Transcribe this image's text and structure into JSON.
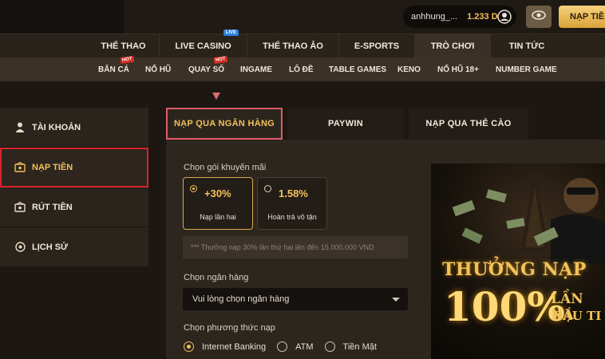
{
  "header": {
    "username": "anhhung_...",
    "balance": "1.233 D",
    "deposit_button": "NẠP TIỀN"
  },
  "main_nav": [
    {
      "label": "THỂ THAO"
    },
    {
      "label": "LIVE CASINO",
      "badge": "LIVE"
    },
    {
      "label": "THỂ THAO ẢO"
    },
    {
      "label": "E-SPORTS"
    },
    {
      "label": "TRÒ CHƠI",
      "active": true
    },
    {
      "label": "TIN TỨC"
    }
  ],
  "sub_nav": [
    {
      "label": "BẮN CÁ",
      "badge": "HOT"
    },
    {
      "label": "NỔ HŨ"
    },
    {
      "label": "QUAY SỐ",
      "badge": "HOT"
    },
    {
      "label": "INGAME"
    },
    {
      "label": "LÔ ĐỀ"
    },
    {
      "label": "TABLE GAMES"
    },
    {
      "label": "KENO"
    },
    {
      "label": "NỔ HŨ 18+"
    },
    {
      "label": "NUMBER GAME"
    }
  ],
  "sidebar": [
    {
      "label": "TÀI KHOẢN",
      "icon": "user-icon"
    },
    {
      "label": "NẠP TIỀN",
      "icon": "wallet-in-icon",
      "active": true
    },
    {
      "label": "RÚT TIỀN",
      "icon": "wallet-out-icon"
    },
    {
      "label": "LỊCH SỬ",
      "icon": "history-icon"
    }
  ],
  "tabs": [
    {
      "label": "NẠP QUA NGÂN HÀNG",
      "active": true
    },
    {
      "label": "PAYWIN"
    },
    {
      "label": "NẠP QUA THẺ CÀO"
    }
  ],
  "form": {
    "promo_label": "Chọn gói khuyến mãi",
    "promos": [
      {
        "value": "+30%",
        "desc": "Nạp lần hai",
        "selected": true
      },
      {
        "value": "1.58%",
        "desc": "Hoàn trả vô tận",
        "selected": false
      }
    ],
    "promo_note": "*** Thưởng nạp 30% lần thứ hai lên đến 15.000.000 VND",
    "bank_label": "Chọn ngân hàng",
    "bank_placeholder": "Vui lòng chọn ngân hàng",
    "method_label": "Chọn phương thức nạp",
    "methods": [
      {
        "label": "Internet Banking",
        "selected": true
      },
      {
        "label": "ATM",
        "selected": false
      },
      {
        "label": "Tiền Mặt",
        "selected": false
      }
    ]
  },
  "banner": {
    "line1": "THƯỞNG NẠP",
    "line2": "100%",
    "line3": "LẦN NẠ",
    "line4": "ĐẦU TI"
  },
  "colors": {
    "accent_gold": "#f2c15a",
    "highlight_red": "#d8232a",
    "panel_bg": "#2c261f"
  }
}
